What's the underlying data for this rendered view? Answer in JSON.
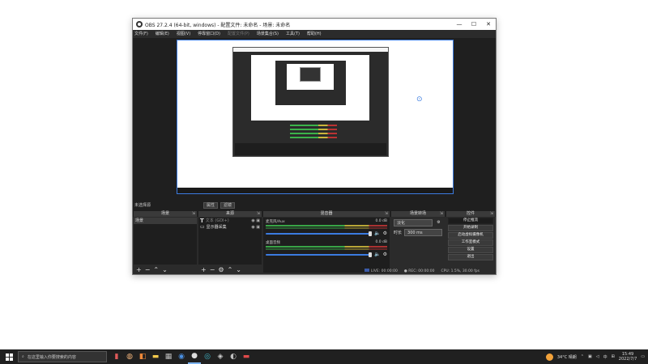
{
  "window": {
    "title": "OBS 27.2.4 (64-bit, windows) - 配置文件: 未命名 - 场景: 未命名",
    "controls": {
      "minimize": "—",
      "maximize": "☐",
      "close": "✕"
    }
  },
  "menu": [
    {
      "label": "文件(F)",
      "enabled": true
    },
    {
      "label": "编辑(E)",
      "enabled": true
    },
    {
      "label": "视图(V)",
      "enabled": true
    },
    {
      "label": "停靠窗口(D)",
      "enabled": true
    },
    {
      "label": "配置文件(P)",
      "enabled": false
    },
    {
      "label": "场景集合(S)",
      "enabled": true
    },
    {
      "label": "工具(T)",
      "enabled": true
    },
    {
      "label": "帮助(H)",
      "enabled": true
    }
  ],
  "scene_bar": {
    "label": "未选择源",
    "properties": "属性",
    "filters": "滤镜"
  },
  "docks": {
    "scenes": {
      "title": "场景",
      "items": [
        "场景"
      ]
    },
    "sources": {
      "title": "来源",
      "items": [
        {
          "name": "文本 (GDI+)",
          "icon": "text-icon"
        },
        {
          "name": "显示器采集",
          "icon": "monitor-icon"
        }
      ]
    },
    "mixer": {
      "title": "混音器",
      "channels": [
        {
          "name": "麦克风/Aux",
          "db": "0.0 dB"
        },
        {
          "name": "桌面音频",
          "db": "0.0 dB"
        }
      ]
    },
    "transitions": {
      "title": "场景转场",
      "type": "淡化",
      "duration_label": "时长",
      "duration": "300 ms"
    },
    "controls": {
      "title": "控件",
      "buttons": [
        "停止推流",
        "开始录制",
        "启动虚拟摄像机",
        "工作室模式",
        "设置",
        "退出"
      ]
    }
  },
  "status": {
    "live": "LIVE: 00:00:00",
    "rec": "REC: 00:00:00",
    "cpu": "CPU: 1.5%, 30.00 fps"
  },
  "taskbar": {
    "search_placeholder": "在这里输入你要搜索的内容",
    "weather": "34°C 晴朗",
    "ime": "中",
    "time": "15:49",
    "date": "2022/7/7"
  },
  "colors": {
    "accent": "#3b7be0",
    "obs_bg": "#2b2b2b",
    "taskbar": "#202020"
  }
}
